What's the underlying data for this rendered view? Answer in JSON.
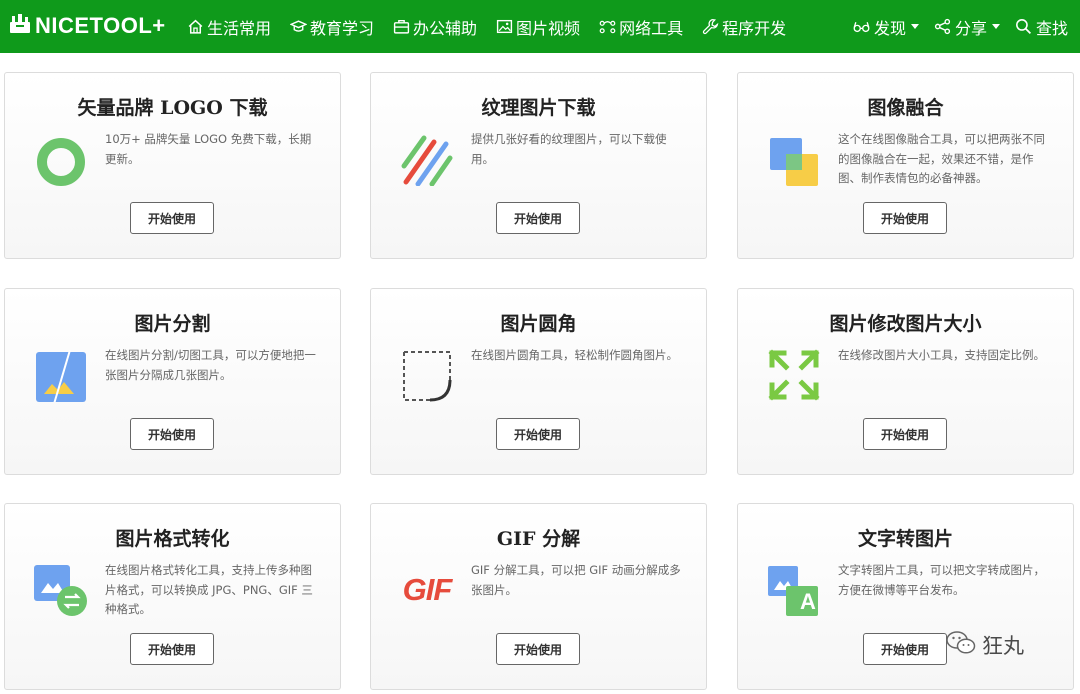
{
  "brand": {
    "name": "NICETOOL+"
  },
  "nav": {
    "left": [
      {
        "label": "生活常用",
        "icon": "home-icon"
      },
      {
        "label": "教育学习",
        "icon": "graduation-cap-icon"
      },
      {
        "label": "办公辅助",
        "icon": "briefcase-icon"
      },
      {
        "label": "图片视频",
        "icon": "image-icon"
      },
      {
        "label": "网络工具",
        "icon": "network-icon"
      },
      {
        "label": "程序开发",
        "icon": "wrench-icon"
      }
    ],
    "right": [
      {
        "label": "发现",
        "icon": "glasses-icon"
      },
      {
        "label": "分享",
        "icon": "share-icon"
      },
      {
        "label": "查找",
        "icon": "search-icon"
      }
    ]
  },
  "cards": [
    {
      "title": "矢量品牌 LOGO 下载",
      "desc": "10万+ 品牌矢量 LOGO 免费下载，长期更新。",
      "button": "开始使用",
      "icon": "ring-icon"
    },
    {
      "title": "纹理图片下载",
      "desc": "提供几张好看的纹理图片，可以下载使用。",
      "button": "开始使用",
      "icon": "stripes-icon"
    },
    {
      "title": "图像融合",
      "desc": "这个在线图像融合工具，可以把两张不同的图像融合在一起，效果还不错，是作图、制作表情包的必备神器。",
      "button": "开始使用",
      "icon": "overlap-icon"
    },
    {
      "title": "图片分割",
      "desc": "在线图片分割/切图工具，可以方便地把一张图片分隔成几张图片。",
      "button": "开始使用",
      "icon": "split-image-icon"
    },
    {
      "title": "图片圆角",
      "desc": "在线图片圆角工具，轻松制作圆角图片。",
      "button": "开始使用",
      "icon": "rounded-corner-icon"
    },
    {
      "title": "图片修改图片大小",
      "desc": "在线修改图片大小工具，支持固定比例。",
      "button": "开始使用",
      "icon": "resize-arrows-icon"
    },
    {
      "title": "图片格式转化",
      "desc": "在线图片格式转化工具，支持上传多种图片格式，可以转换成 JPG、PNG、GIF 三种格式。",
      "button": "开始使用",
      "icon": "image-convert-icon"
    },
    {
      "title": "GIF 分解",
      "desc": "GIF 分解工具，可以把 GIF 动画分解成多张图片。",
      "button": "开始使用",
      "icon": "gif-icon",
      "icon_text": "GIF"
    },
    {
      "title": "文字转图片",
      "desc": "文字转图片工具，可以把文字转成图片，方便在微博等平台发布。",
      "button": "开始使用",
      "icon": "text-to-image-icon",
      "icon_text": "A"
    }
  ],
  "watermark": {
    "text": "狂丸",
    "icon": "wechat-icon"
  },
  "colors": {
    "navbar": "#0f9a1b",
    "green": "#6cc46c",
    "blue": "#6ea2ef",
    "yellow": "#f7cd47",
    "red": "#e64b3c"
  }
}
